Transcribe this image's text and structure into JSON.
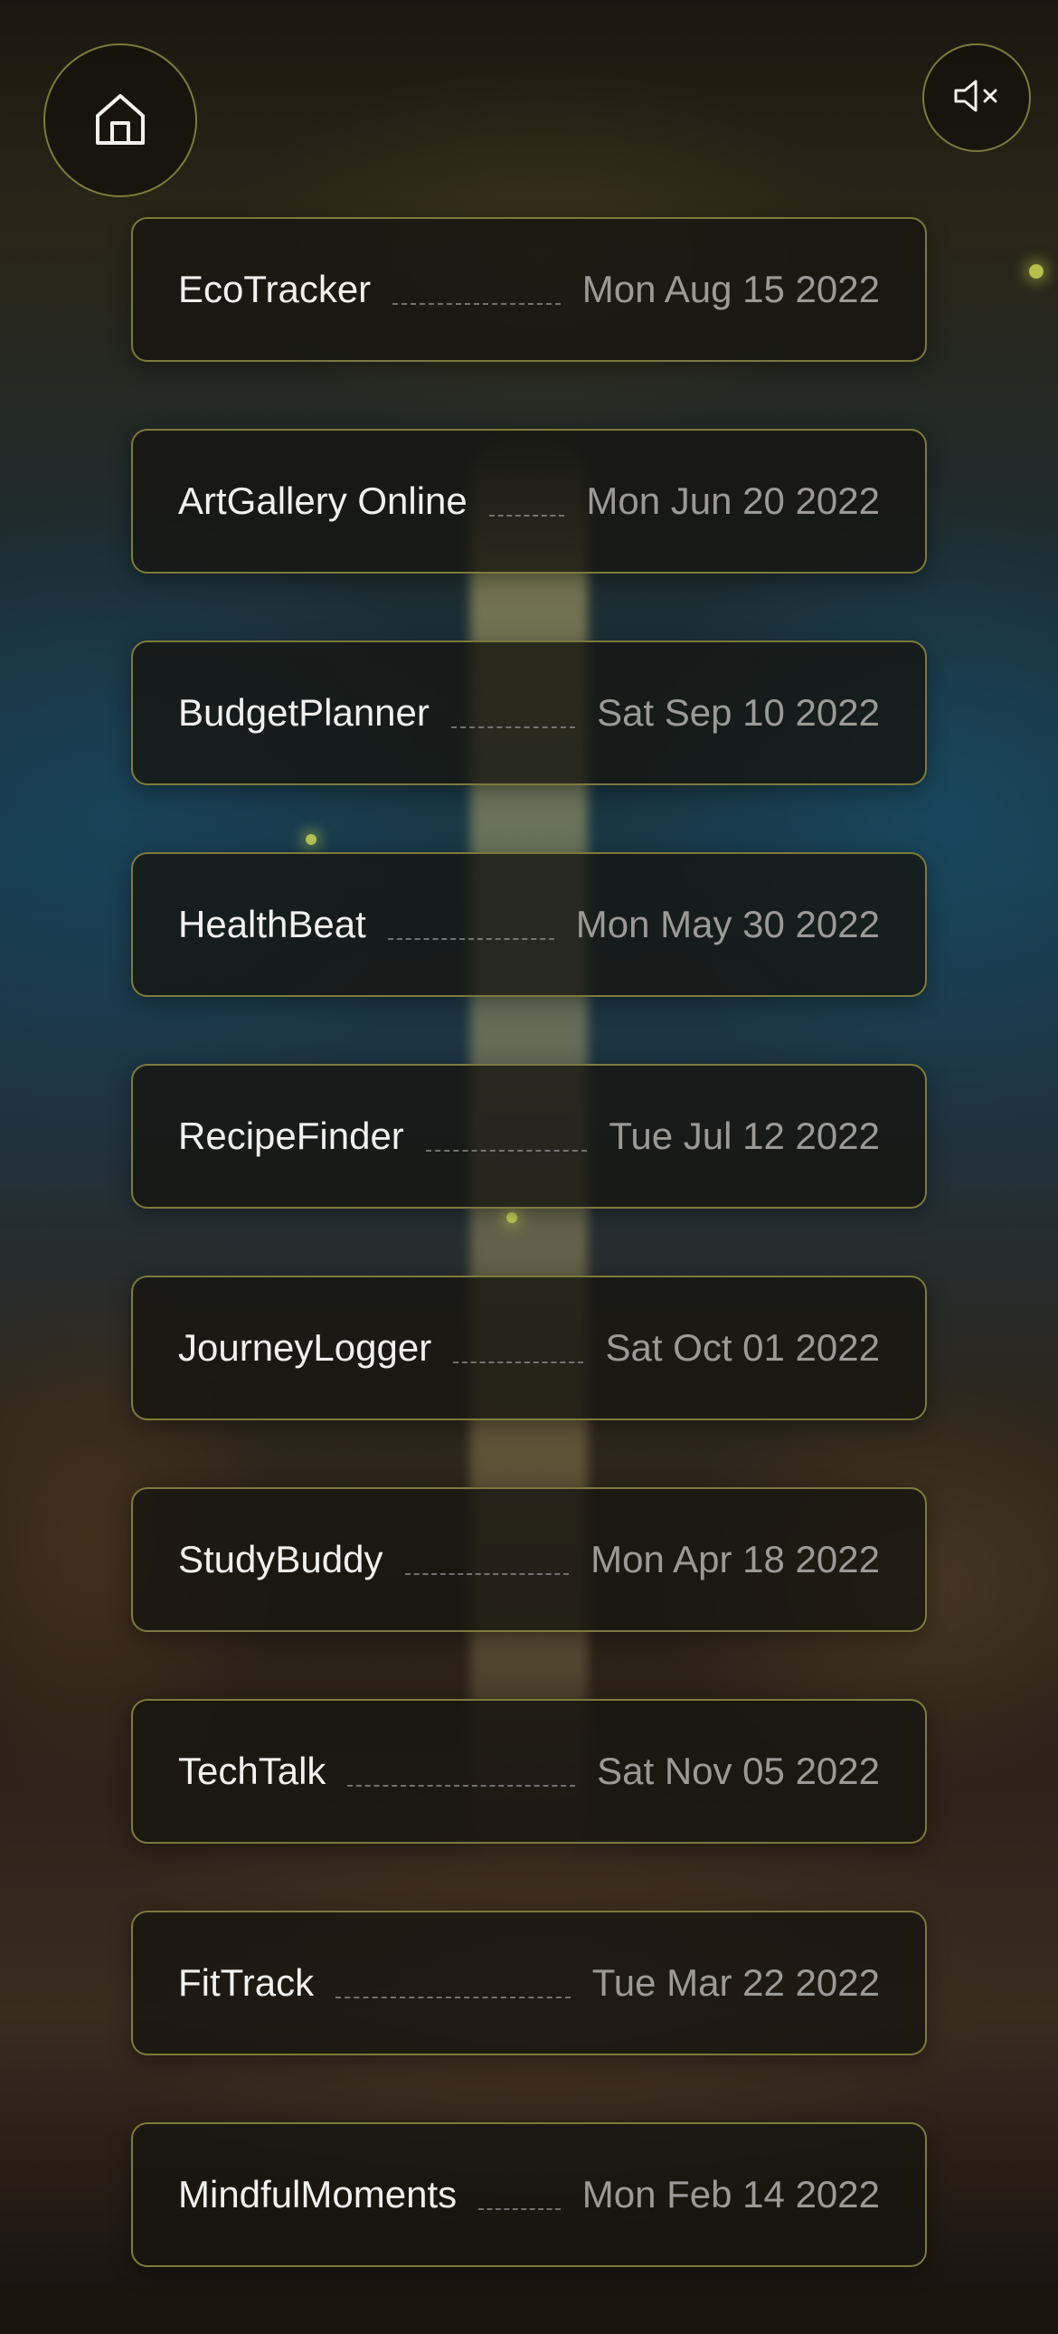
{
  "controls": {
    "home_icon": "home-icon",
    "mute_icon": "speaker-mute-icon"
  },
  "colors": {
    "card_border": "#7d7a3c",
    "title_text": "#f1f1ef",
    "date_text": "#9c9a97"
  },
  "projects": [
    {
      "name": "EcoTracker",
      "date": "Mon Aug 15 2022"
    },
    {
      "name": "ArtGallery Online",
      "date": "Mon Jun 20 2022"
    },
    {
      "name": "BudgetPlanner",
      "date": "Sat Sep 10 2022"
    },
    {
      "name": "HealthBeat",
      "date": "Mon May 30 2022"
    },
    {
      "name": "RecipeFinder",
      "date": "Tue Jul 12 2022"
    },
    {
      "name": "JourneyLogger",
      "date": "Sat Oct 01 2022"
    },
    {
      "name": "StudyBuddy",
      "date": "Mon Apr 18 2022"
    },
    {
      "name": "TechTalk",
      "date": "Sat Nov 05 2022"
    },
    {
      "name": "FitTrack",
      "date": "Tue Mar 22 2022"
    },
    {
      "name": "MindfulMoments",
      "date": "Mon Feb 14 2022"
    }
  ]
}
